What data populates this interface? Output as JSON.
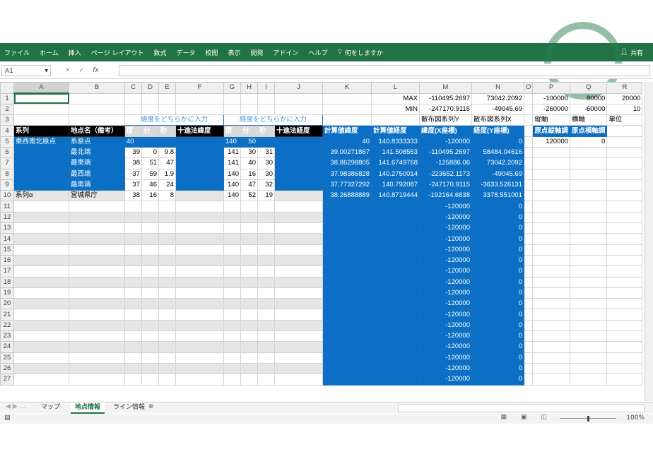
{
  "ribbon": {
    "menu": [
      "ファイル",
      "ホーム",
      "挿入",
      "ページ レイアウト",
      "数式",
      "データ",
      "校閲",
      "表示",
      "開発",
      "アドイン",
      "ヘルプ"
    ],
    "tell_me": "何をしますか",
    "share": "共有"
  },
  "formula_bar": {
    "name_box": "A1",
    "fx": "fx",
    "value": ""
  },
  "columns": [
    "A",
    "B",
    "C",
    "D",
    "E",
    "F",
    "G",
    "H",
    "I",
    "J",
    "K",
    "L",
    "M",
    "N",
    "O",
    "P",
    "Q",
    "R"
  ],
  "rows": {
    "r1": {
      "L": "MAX",
      "M": "-110495.2697",
      "N": "73042.2092",
      "P": "-100000",
      "Q": "80000",
      "R": "20000"
    },
    "r2": {
      "L": "MIN",
      "M": "-247170.9115",
      "N": "-49045.69",
      "P": "-260000",
      "Q": "-60000",
      "R": "10"
    },
    "r3": {
      "lat_note": "緯度をどちらかに入力",
      "lon_note": "経度をどちらかに入力",
      "M": "散布図系列Y",
      "N": "散布図系列X",
      "P": "縦軸",
      "Q": "横軸",
      "R": "単位"
    },
    "r4": {
      "A": "系列",
      "B": "地点名（備考）",
      "C": "度",
      "D": "分",
      "E": "秒",
      "F": "十進法緯度",
      "G": "度",
      "H": "分",
      "I": "秒",
      "J": "十進法経度",
      "K": "計算値緯度",
      "L": "計算値経度",
      "M": "緯度(X座標)",
      "N": "経度(Y座標)",
      "P": "原点縦軸調",
      "Q": "原点横軸調"
    },
    "data": [
      {
        "r": "5",
        "A": "東西南北原点",
        "B": "系原点",
        "C": "40",
        "D": "",
        "E": "",
        "G": "140",
        "H": "50",
        "I": "",
        "K": "40",
        "L": "140.8333333",
        "M": "-120000",
        "N": "0",
        "P": "120000",
        "Q": "0"
      },
      {
        "r": "6",
        "A": "",
        "B": "最北端",
        "C": "39",
        "D": "0",
        "E": "9.8",
        "G": "141",
        "H": "30",
        "I": "31",
        "K": "39.00271867",
        "L": "141.508553",
        "M": "-110495.2697",
        "N": "58484.04616"
      },
      {
        "r": "7",
        "A": "",
        "B": "最東端",
        "C": "38",
        "D": "51",
        "E": "47",
        "G": "141",
        "H": "40",
        "I": "30",
        "K": "38.86298805",
        "L": "141.6749768",
        "M": "-125886.06",
        "N": "73042.2092"
      },
      {
        "r": "8",
        "A": "",
        "B": "最西端",
        "C": "37",
        "D": "59",
        "E": "1.9",
        "G": "140",
        "H": "16",
        "I": "30",
        "K": "37.98386828",
        "L": "140.2750014",
        "M": "-223652.1173",
        "N": "-49045.69"
      },
      {
        "r": "9",
        "A": "",
        "B": "最南端",
        "C": "37",
        "D": "46",
        "E": "24",
        "G": "140",
        "H": "47",
        "I": "32",
        "K": "37.77327292",
        "L": "140.792087",
        "M": "-247170.9115",
        "N": "-3633.526131"
      },
      {
        "r": "10",
        "A": "系列α",
        "B": "宮城県庁",
        "C": "38",
        "D": "16",
        "E": "8",
        "G": "140",
        "H": "52",
        "I": "19",
        "K": "38.26888889",
        "L": "140.8719444",
        "M": "-192164.6838",
        "N": "3378.551001"
      }
    ],
    "empty_rows": [
      "11",
      "12",
      "13",
      "14",
      "15",
      "16",
      "17",
      "18",
      "19",
      "20",
      "21",
      "22",
      "23",
      "24",
      "25",
      "26",
      "27"
    ],
    "empty_M": "-120000",
    "empty_N": "0"
  },
  "row_labels": [
    "1",
    "2",
    "3",
    "4"
  ],
  "sheet_tabs": [
    "マップ",
    "地点情報",
    "ライン情報"
  ],
  "active_tab": 1,
  "status": {
    "zoom": "100%"
  }
}
